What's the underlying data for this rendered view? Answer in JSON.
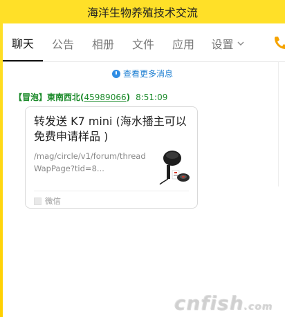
{
  "window": {
    "title": "海洋生物养殖技术交流"
  },
  "tabs": [
    {
      "label": "聊天",
      "active": true
    },
    {
      "label": "公告",
      "active": false
    },
    {
      "label": "相册",
      "active": false
    },
    {
      "label": "文件",
      "active": false
    },
    {
      "label": "应用",
      "active": false
    },
    {
      "label": "设置",
      "active": false,
      "has_dropdown": true
    }
  ],
  "chat": {
    "more_messages": "查看更多消息",
    "message": {
      "sender_tag": "【冒泡】",
      "sender_name": "東南西北(",
      "sender_qq": "45989066",
      "sender_close": ")",
      "time": "8:51:09",
      "card": {
        "title": "转发送 K7 mini (海水播主可以免费申请样品 )",
        "desc": "/mag/circle/v1/forum/threadWapPage?tid=8...",
        "source": "微信",
        "thumbnail_icon": "product-thumbnail"
      }
    }
  },
  "watermark": {
    "text": "cnfish",
    "suffix": ".com"
  },
  "colors": {
    "titlebar": "#ffe028",
    "sender": "#1b8a2a",
    "link": "#1a7dd1",
    "phone_icon": "#f5a300"
  }
}
